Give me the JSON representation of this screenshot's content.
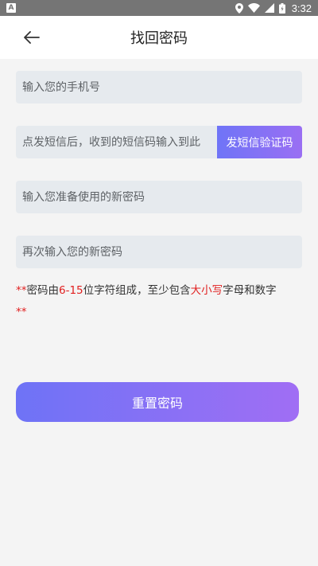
{
  "status_bar": {
    "app_badge": "A",
    "time": "3:32"
  },
  "header": {
    "title": "找回密码"
  },
  "form": {
    "phone_placeholder": "输入您的手机号",
    "sms_placeholder": "点发短信后，收到的短信码输入到此",
    "sms_button_label": "发短信验证码",
    "new_password_placeholder": "输入您准备使用的新密码",
    "confirm_password_placeholder": "再次输入您的新密码"
  },
  "hint": {
    "prefix_marker": "**",
    "part1": "密码由",
    "range": "6-15",
    "part2": "位字符组成，至少包含",
    "case_text": "大小写",
    "part3": "字母和数字",
    "suffix_marker": "**"
  },
  "reset_button_label": "重置密码",
  "colors": {
    "accent_start": "#6e73f6",
    "accent_end": "#a06ef4",
    "warning_red": "#e12020",
    "field_bg": "#e6eaee"
  }
}
